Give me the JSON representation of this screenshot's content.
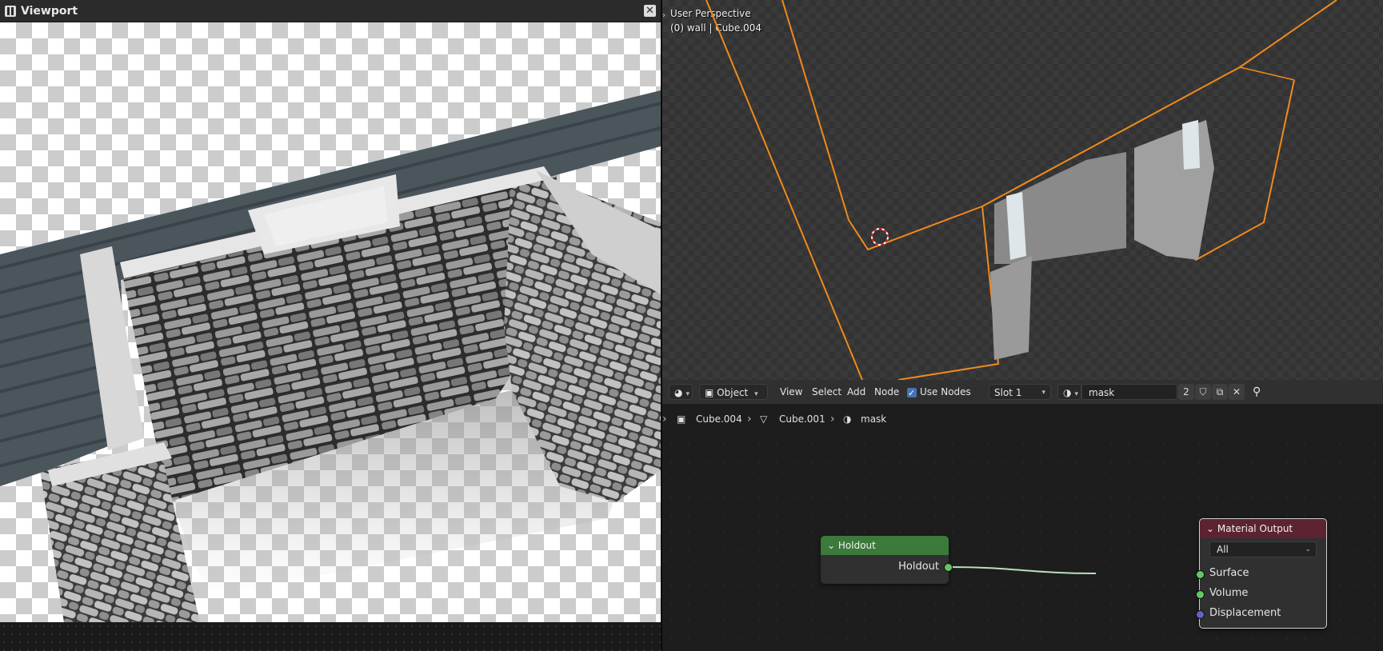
{
  "left_window": {
    "title": "Viewport",
    "close_label": "✕"
  },
  "viewport3d": {
    "perspective_label": "User Perspective",
    "object_label": "(0) wall | Cube.004"
  },
  "node_header": {
    "mode_label": "Object",
    "menus": [
      "View",
      "Select",
      "Add",
      "Node"
    ],
    "use_nodes_label": "Use Nodes",
    "slot_label": "Slot 1",
    "material_name": "mask",
    "user_count": "2"
  },
  "breadcrumb": {
    "object": "Cube.004",
    "mesh": "Cube.001",
    "material": "mask"
  },
  "nodes": {
    "holdout": {
      "title": "Holdout",
      "output": "Holdout",
      "header_color": "#3b7a3b"
    },
    "material_output": {
      "title": "Material Output",
      "target": "All",
      "inputs": [
        "Surface",
        "Volume",
        "Displacement"
      ],
      "header_color": "#5c2330"
    }
  },
  "colors": {
    "selection_orange": "#f08a1c",
    "link_green": "#b9e0b9"
  }
}
